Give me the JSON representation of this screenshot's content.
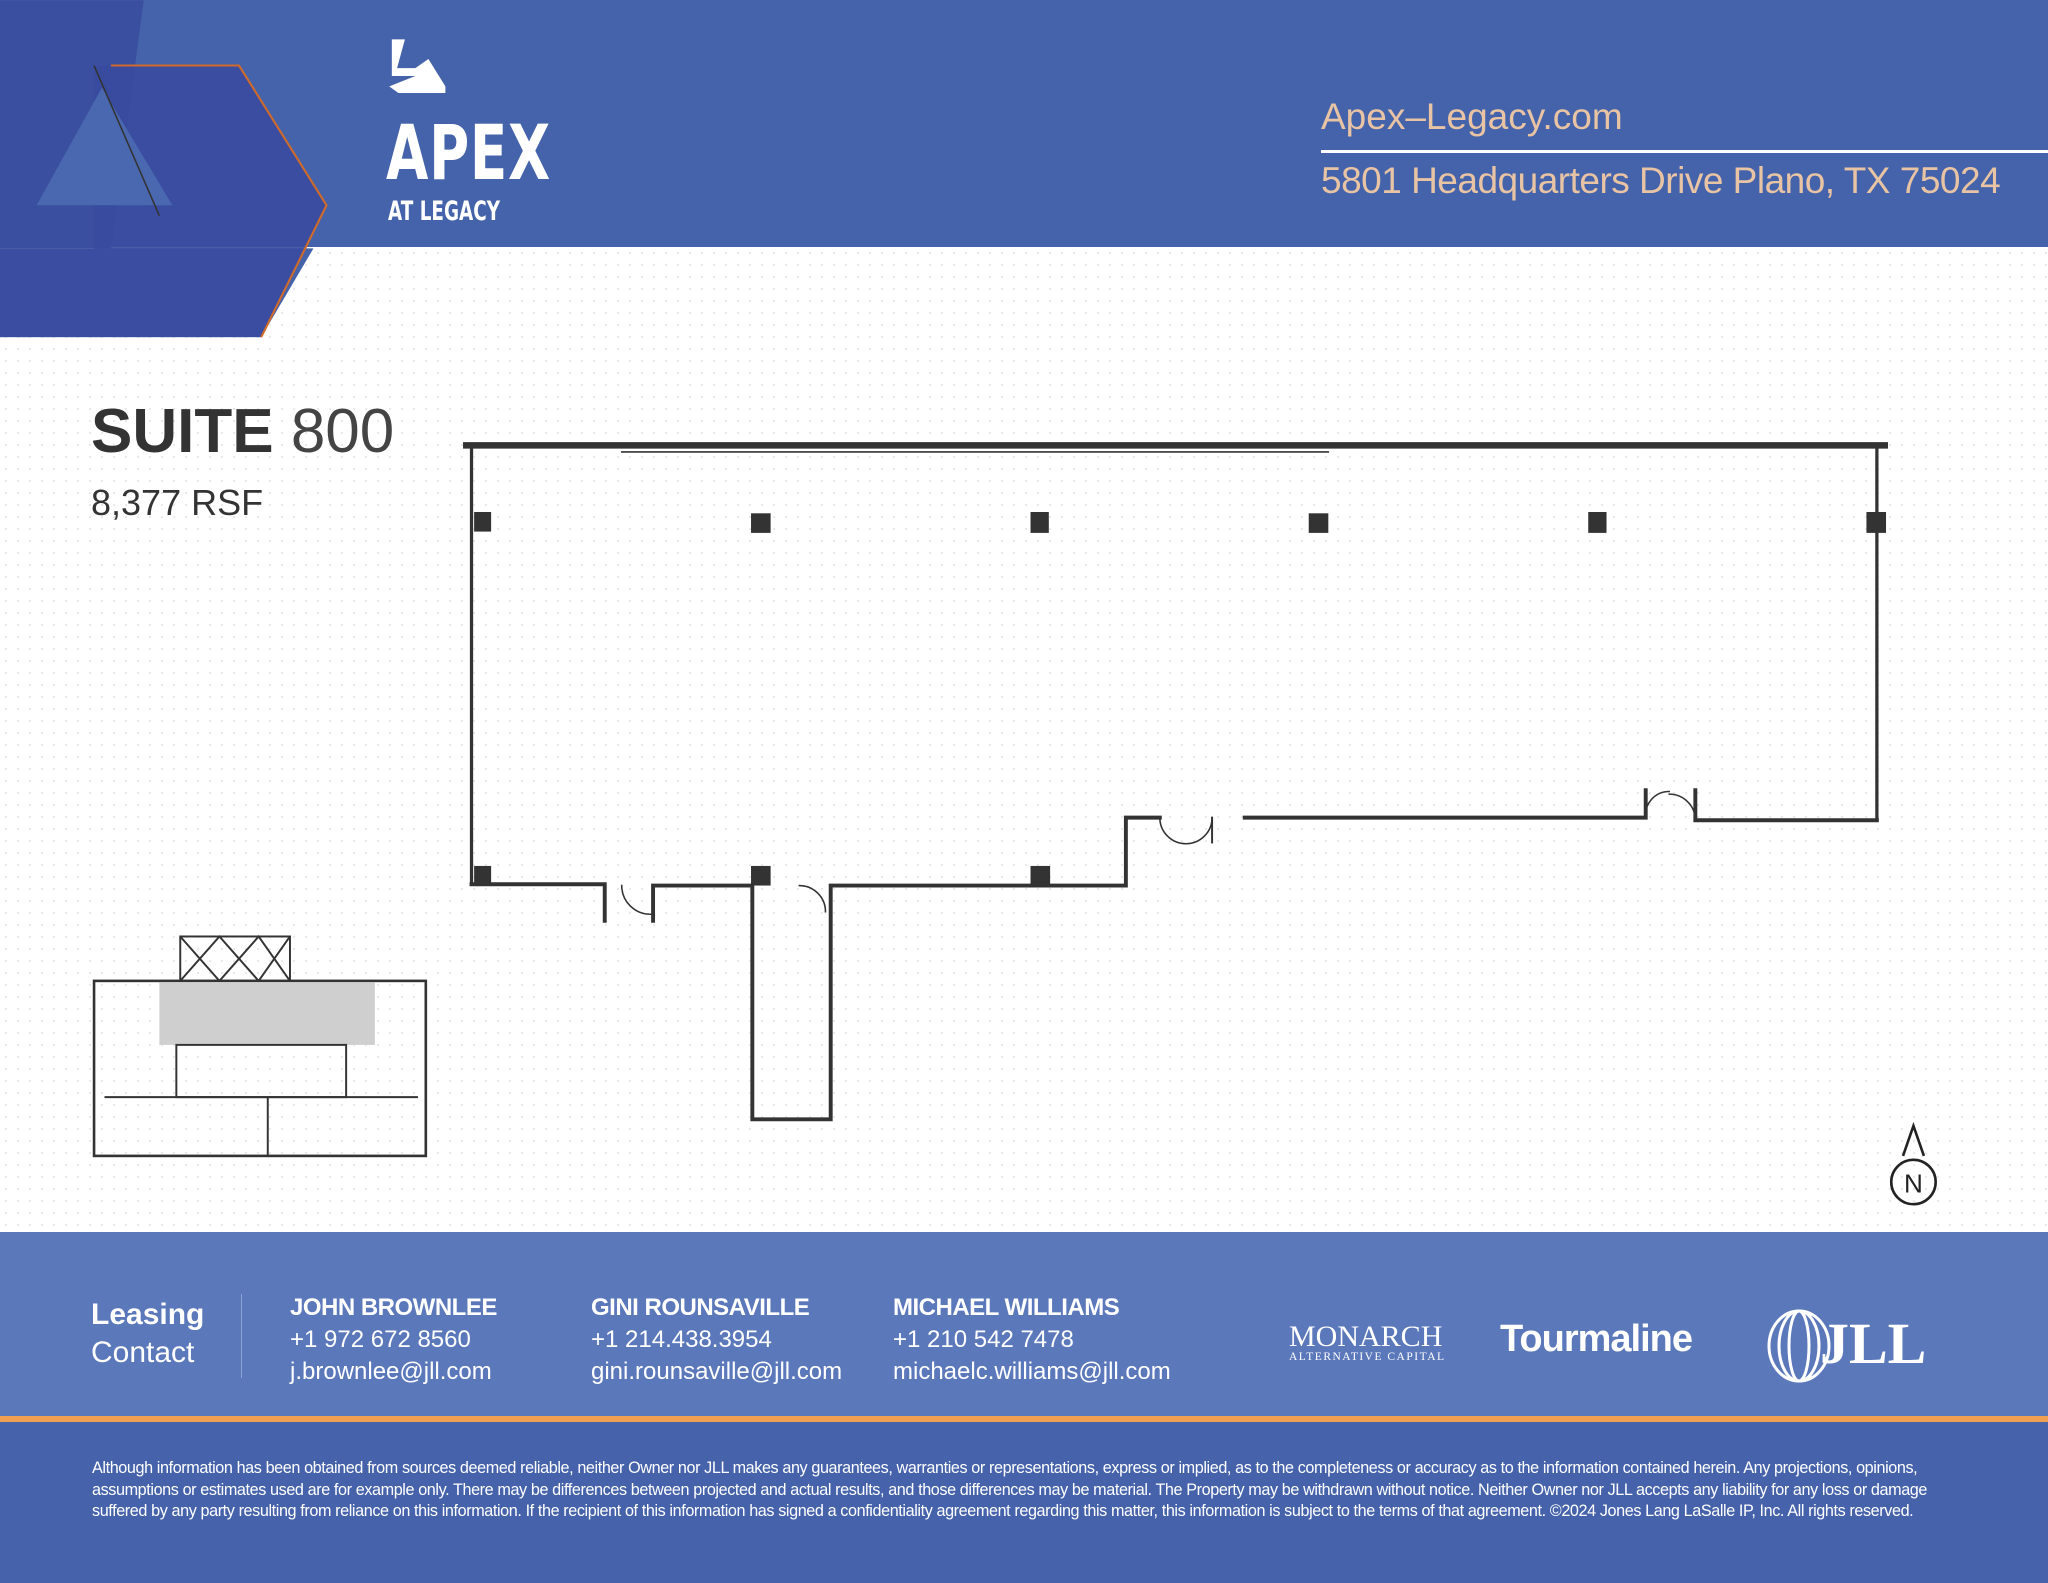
{
  "brand": {
    "logo_word": "APEX",
    "logo_sub": "AT LEGACY",
    "colors": {
      "header": "#4563aa",
      "accent": "#e8c4a4",
      "orange": "#f0a050",
      "footer": "#5b78bb"
    }
  },
  "header": {
    "url": "Apex–Legacy.com",
    "address": "5801 Headquarters Drive Plano, TX 75024"
  },
  "suite": {
    "label": "SUITE",
    "number": "800",
    "area": "8,377 RSF"
  },
  "compass": {
    "label": "N"
  },
  "contact": {
    "heading_1": "Leasing",
    "heading_2": "Contact",
    "people": [
      {
        "name": "JOHN BROWNLEE",
        "phone": "+1 972 672 8560",
        "email": "j.brownlee@jll.com"
      },
      {
        "name": "GINI ROUNSAVILLE",
        "phone": "+1 214.438.3954",
        "email": "gini.rounsaville@jll.com"
      },
      {
        "name": "MICHAEL WILLIAMS",
        "phone": "+1 210 542 7478",
        "email": "michaelc.williams@jll.com"
      }
    ],
    "logos": {
      "monarch": "MONARCH",
      "monarch_sub": "ALTERNATIVE CAPITAL",
      "tourmaline": "Tourmaline",
      "jll": "JLL"
    }
  },
  "disclaimer": "Although information has been obtained from sources deemed reliable, neither Owner nor JLL makes any guarantees, warranties or representations, express or implied, as to the completeness or accuracy as to the information contained herein. Any projections, opinions, assumptions or estimates used are for example only. There may be differences between projected and actual results, and those differences may be material. The Property may be withdrawn without notice. Neither Owner nor JLL accepts any liability for any loss or damage suffered by any party resulting from reliance on this information. If the recipient of this information has signed a confidentiality agreement regarding this matter, this information is subject to the terms of that agreement. ©2024 Jones Lang LaSalle IP, Inc. All rights reserved."
}
